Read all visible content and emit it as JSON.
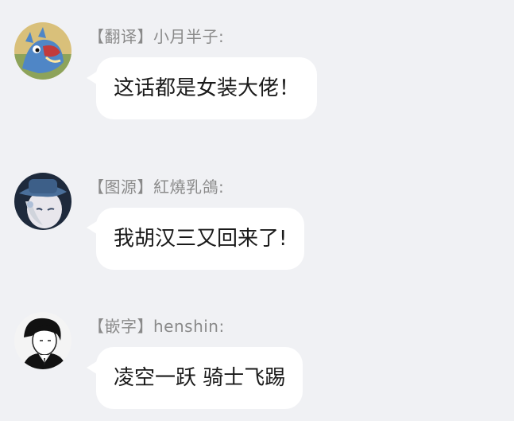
{
  "messages": [
    {
      "sender": "【翻译】小月半子:",
      "text": "这话都是女装大佬！",
      "avatar_icon": "cartoon-monster-avatar-icon"
    },
    {
      "sender": "【图源】紅燒乳鴿:",
      "text": "我胡汉三又回来了!",
      "avatar_icon": "anime-hat-character-avatar-icon"
    },
    {
      "sender": "【嵌字】henshin:",
      "text": "凌空一跃 骑士飞踢",
      "avatar_icon": "dark-hair-man-avatar-icon"
    }
  ],
  "colors": {
    "background": "#f0f1f4",
    "bubble": "#ffffff",
    "sender_text": "#8a8a8a",
    "message_text": "#1a1a1a"
  }
}
